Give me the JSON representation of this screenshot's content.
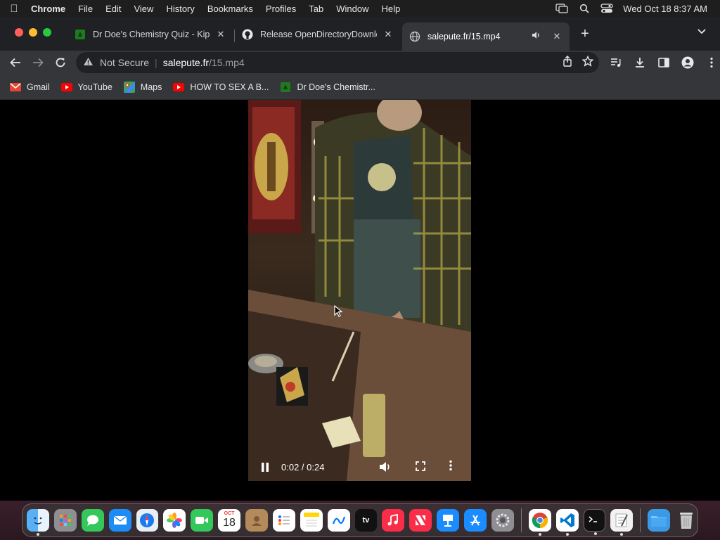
{
  "menubar": {
    "app": "Chrome",
    "items": [
      "File",
      "Edit",
      "View",
      "History",
      "Bookmarks",
      "Profiles",
      "Tab",
      "Window",
      "Help"
    ],
    "clock": "Wed Oct 18  8:37 AM"
  },
  "tabs": [
    {
      "title": "Dr Doe's Chemistry Quiz - Kip",
      "icon": "chemistry-favicon-icon"
    },
    {
      "title": "Release OpenDirectoryDownlo",
      "icon": "github-icon"
    },
    {
      "title": "salepute.fr/15.mp4",
      "icon": "globe-icon",
      "active": true
    }
  ],
  "omnibox": {
    "security": "Not Secure",
    "host": "salepute.fr",
    "path": "/15.mp4"
  },
  "bookmarks": [
    {
      "label": "Gmail",
      "icon": "gmail-icon"
    },
    {
      "label": "YouTube",
      "icon": "youtube-icon"
    },
    {
      "label": "Maps",
      "icon": "maps-icon"
    },
    {
      "label": "HOW TO SEX A B...",
      "icon": "youtube-icon"
    },
    {
      "label": "Dr Doe's Chemistr...",
      "icon": "chemistry-favicon-icon"
    }
  ],
  "video": {
    "time": "0:02 / 0:24",
    "progress": 0.1
  },
  "dock": {
    "calendar_month": "OCT",
    "calendar_day": "18",
    "tv_label": "tv"
  },
  "colors": {
    "tabstrip": "#202124",
    "toolbar": "#35363a",
    "close": "#ff5f57",
    "minimize": "#febc2e",
    "zoom": "#28c840"
  }
}
